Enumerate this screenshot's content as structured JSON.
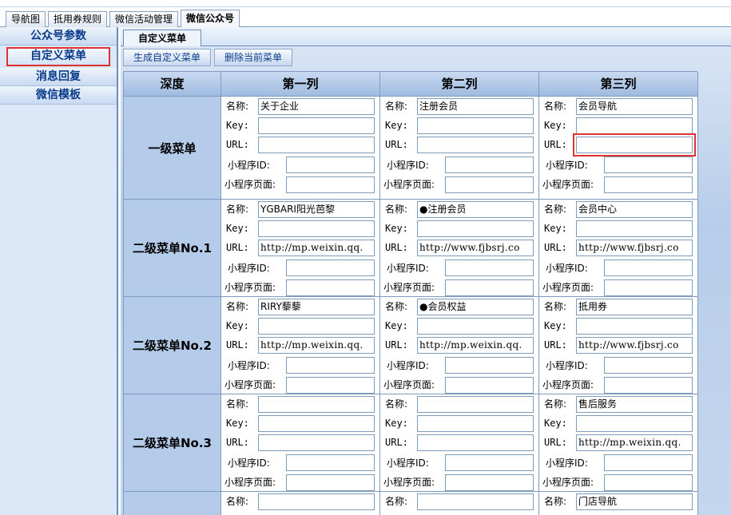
{
  "top_tabs": [
    "导航图",
    "抵用券规则",
    "微信活动管理",
    "微信公众号"
  ],
  "sidebar": [
    "公众号参数",
    "自定义菜单",
    "消息回复",
    "微信模板"
  ],
  "sub_tab": "自定义菜单",
  "toolbar": {
    "generate": "生成自定义菜单",
    "delete": "删除当前菜单"
  },
  "header": {
    "depth": "深度",
    "col1": "第一列",
    "col2": "第二列",
    "col3": "第三列"
  },
  "field_labels": {
    "name": "名称:",
    "key": "Key:",
    "url": "URL:",
    "mini_id": "小程序ID:",
    "mini_page": "小程序页面:"
  },
  "rows": [
    {
      "depth": "一级菜单",
      "cols": [
        {
          "name": "关于企业",
          "key": "",
          "url": "",
          "mini_id": "",
          "mini_page": ""
        },
        {
          "name": "注册会员",
          "key": "",
          "url": "",
          "mini_id": "",
          "mini_page": ""
        },
        {
          "name": "会员导航",
          "key": "",
          "url": "",
          "mini_id": "",
          "mini_page": ""
        }
      ]
    },
    {
      "depth": "二级菜单No.1",
      "cols": [
        {
          "name": "YGBARI阳光芭黎",
          "key": "",
          "url": "http://mp.weixin.qq.",
          "mini_id": "",
          "mini_page": ""
        },
        {
          "name": "●注册会员",
          "key": "",
          "url": "http://www.fjbsrj.co",
          "mini_id": "",
          "mini_page": ""
        },
        {
          "name": "会员中心",
          "key": "",
          "url": "http://www.fjbsrj.co",
          "mini_id": "",
          "mini_page": ""
        }
      ]
    },
    {
      "depth": "二级菜单No.2",
      "cols": [
        {
          "name": "RIRY藜藜",
          "key": "",
          "url": "http://mp.weixin.qq.",
          "mini_id": "",
          "mini_page": ""
        },
        {
          "name": "●会员权益",
          "key": "",
          "url": "http://mp.weixin.qq.",
          "mini_id": "",
          "mini_page": ""
        },
        {
          "name": "抵用券",
          "key": "",
          "url": "http://www.fjbsrj.co",
          "mini_id": "",
          "mini_page": ""
        }
      ]
    },
    {
      "depth": "二级菜单No.3",
      "cols": [
        {
          "name": "",
          "key": "",
          "url": "",
          "mini_id": "",
          "mini_page": ""
        },
        {
          "name": "",
          "key": "",
          "url": "",
          "mini_id": "",
          "mini_page": ""
        },
        {
          "name": "售后服务",
          "key": "",
          "url": "http://mp.weixin.qq.",
          "mini_id": "",
          "mini_page": ""
        }
      ]
    },
    {
      "depth": "",
      "cols": [
        {
          "name": "",
          "key": "",
          "url": "",
          "mini_id": "",
          "mini_page": ""
        },
        {
          "name": "",
          "key": "",
          "url": "",
          "mini_id": "",
          "mini_page": ""
        },
        {
          "name": "门店导航",
          "key": "",
          "url": "",
          "mini_id": "",
          "mini_page": ""
        }
      ]
    }
  ],
  "highlight": {
    "sidebar_item": 1,
    "row": 0,
    "col": 2,
    "field": "url"
  },
  "colors": {
    "highlight": "#e03131",
    "sidebar_bg": "#dce8f7",
    "header_bg": "#a5bfe2"
  }
}
